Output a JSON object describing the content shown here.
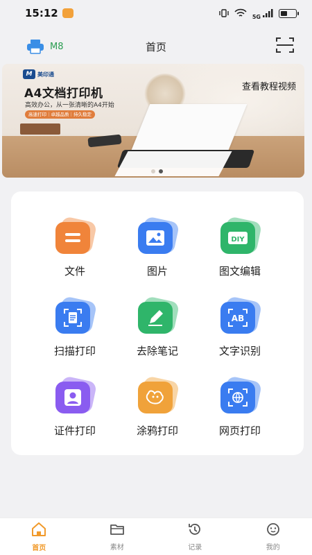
{
  "status_bar": {
    "time": "15:12",
    "network_label": "5G",
    "battery_level": 0.45
  },
  "header": {
    "device_name": "M8",
    "title": "首页"
  },
  "banner": {
    "brand": "美印通",
    "title": "A4文档打印机",
    "subtitle": "高效办公，从一张清晰的A4开始",
    "chip": "高速打印｜卓越品质｜持久稳定",
    "link": "查看教程视频",
    "slides": 2,
    "active_slide": 2
  },
  "features": [
    {
      "label": "文件",
      "icon": "document-icon",
      "color": "#f0843a"
    },
    {
      "label": "图片",
      "icon": "image-icon",
      "color": "#3a7cf0"
    },
    {
      "label": "图文编辑",
      "icon": "diy-icon",
      "color": "#2fb56a"
    },
    {
      "label": "扫描打印",
      "icon": "scan-document-icon",
      "color": "#3a7cf0"
    },
    {
      "label": "去除笔记",
      "icon": "pen-erase-icon",
      "color": "#2fb56a"
    },
    {
      "label": "文字识别",
      "icon": "text-recognition-icon",
      "color": "#3a7cf0"
    },
    {
      "label": "证件打印",
      "icon": "id-card-icon",
      "color": "#8a5cf0"
    },
    {
      "label": "涂鸦打印",
      "icon": "doodle-icon",
      "color": "#f0a23a"
    },
    {
      "label": "网页打印",
      "icon": "web-print-icon",
      "color": "#3a7cf0"
    }
  ],
  "tabs": [
    {
      "label": "首页",
      "icon": "home-icon",
      "active": true
    },
    {
      "label": "素材",
      "icon": "folder-icon",
      "active": false
    },
    {
      "label": "记录",
      "icon": "history-icon",
      "active": false
    },
    {
      "label": "我的",
      "icon": "profile-icon",
      "active": false
    }
  ],
  "colors": {
    "accent": "#f19a2b",
    "device": "#2a9d50",
    "printer_icon": "#3a8ee6"
  }
}
